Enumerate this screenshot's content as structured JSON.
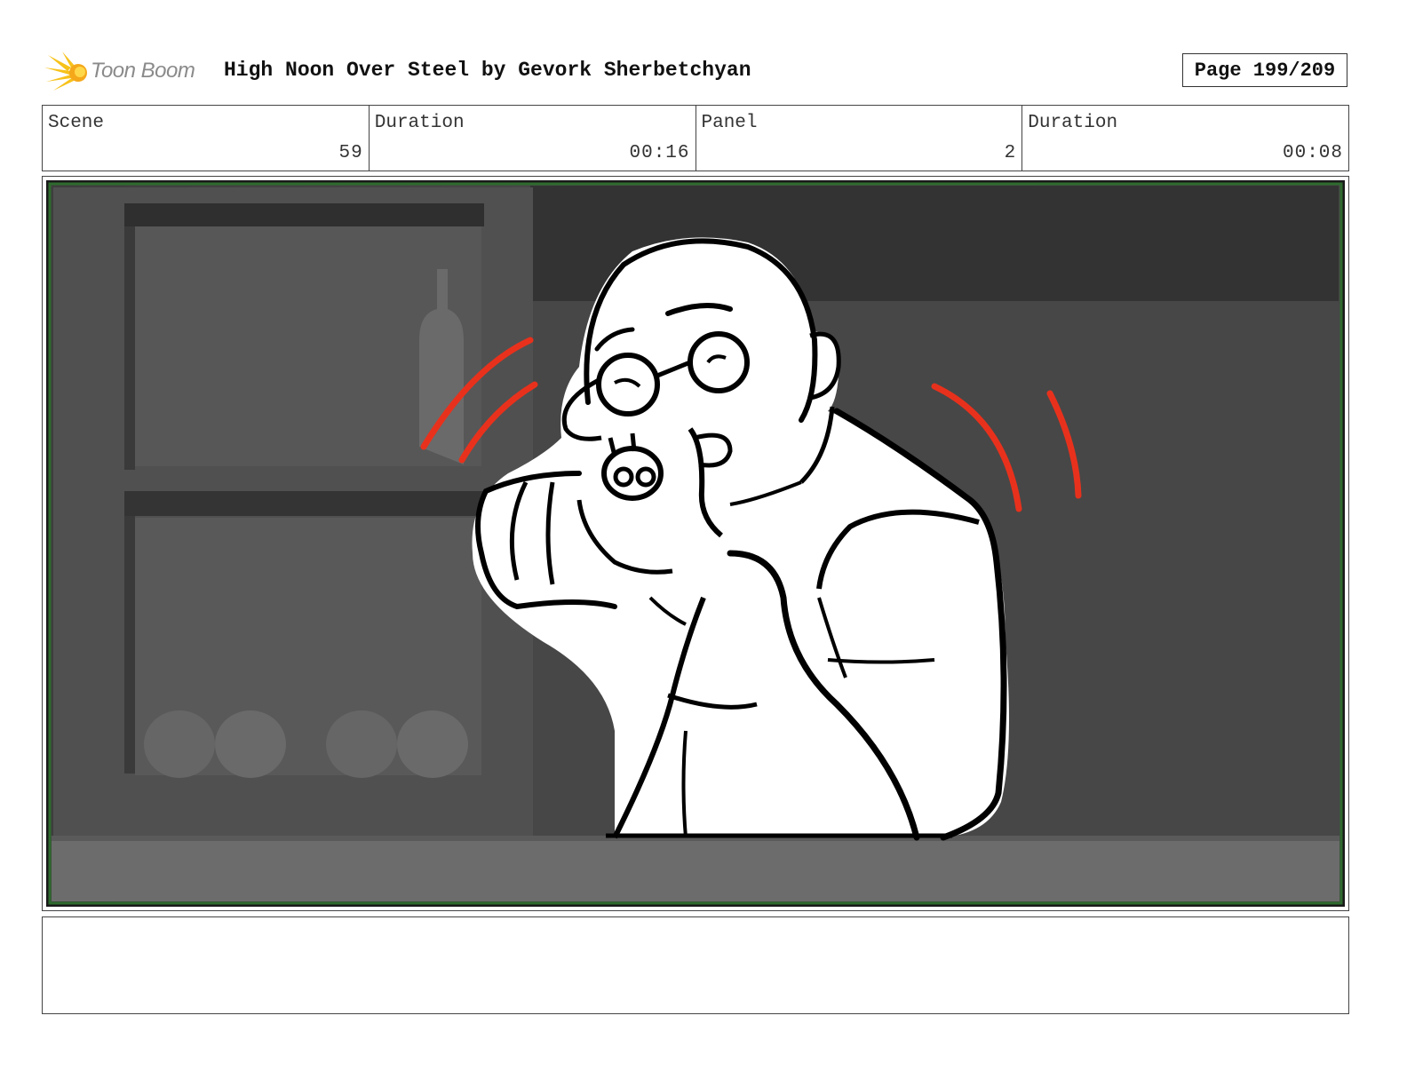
{
  "header": {
    "logo_text": "Toon Boom",
    "title": "High Noon Over Steel by Gevork Sherbetchyan",
    "page": "Page 199/209"
  },
  "info": [
    {
      "label": "Scene",
      "value": "59"
    },
    {
      "label": "Duration",
      "value": "00:16"
    },
    {
      "label": "Panel",
      "value": "2"
    },
    {
      "label": "Duration",
      "value": "00:08"
    }
  ],
  "panel": {
    "border_color": "#2e6b2e",
    "accent_color": "#e8311c"
  },
  "notes": {
    "text": ""
  }
}
